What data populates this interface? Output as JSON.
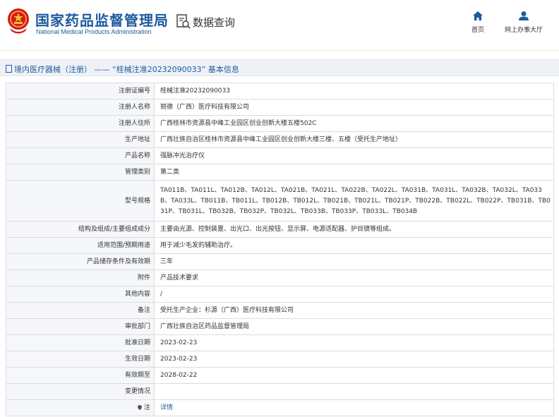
{
  "header": {
    "org_name_cn": "国家药品监督管理局",
    "org_name_en": "National Medical Products Administration",
    "section_title": "数据查询",
    "nav": [
      {
        "label": "首页",
        "icon": "home-icon"
      },
      {
        "label": "网上办事大厅",
        "icon": "user-icon"
      }
    ]
  },
  "breadcrumb": {
    "text": "境内医疗器械（注册） —— “桂械注准20232090033” 基本信息"
  },
  "colors": {
    "brand": "#1d5a9e",
    "emblem_red": "#d7191f",
    "label_bg": "#f5f7fa"
  },
  "record": [
    {
      "label": "注册证编号",
      "value": "桂械注准20232090033"
    },
    {
      "label": "注册人名称",
      "value": "丽德（广西）医疗科技有限公司"
    },
    {
      "label": "注册人住所",
      "value": "广西桂林市资源县中峰工业园区创业创新大楼五楼502C"
    },
    {
      "label": "生产地址",
      "value": "广西壮族自治区桂林市资源县中峰工业园区创业创新大楼三楼、五楼（受托生产地址）"
    },
    {
      "label": "产品名称",
      "value": "强脉冲光治疗仪"
    },
    {
      "label": "管理类别",
      "value": "第二类"
    },
    {
      "label": "型号规格",
      "value": "TA011B、TA011L、TA012B、TA012L、TA021B、TA021L、TA022B、TA022L、TA031B、TA031L、TA032B、TA032L、TA033B、TA033L、TB011B、TB011L、TB012B、TB012L、TB021B、TB021L、TB021P、TB022B、TB022L、TB022P、TB031B、TB031P、TB031L、TB032B、TB032P、TB032L、TB033B、TB033P、TB033L、TB034B"
    },
    {
      "label": "结构及组成/主要组成成分",
      "value": "主要由光源、控制装置、出光口、出光按钮、显示屏、电源适配器、护目镜等组成。"
    },
    {
      "label": "适用范围/预期用途",
      "value": "用于减少毛发的辅助治疗。"
    },
    {
      "label": "产品储存条件及有效期",
      "value": "三年"
    },
    {
      "label": "附件",
      "value": "产品技术要求"
    },
    {
      "label": "其他内容",
      "value": "/"
    },
    {
      "label": "备注",
      "value": "受托生产企业：杉源（广西）医疗科技有限公司"
    },
    {
      "label": "审批部门",
      "value": "广西壮族自治区药品监督管理局"
    },
    {
      "label": "批准日期",
      "value": "2023-02-23"
    },
    {
      "label": "生效日期",
      "value": "2023-02-23"
    },
    {
      "label": "有效期至",
      "value": "2028-02-22"
    },
    {
      "label": "变更情况",
      "value": ""
    },
    {
      "label": "注",
      "value": "详情",
      "icon": "pin-icon"
    }
  ]
}
